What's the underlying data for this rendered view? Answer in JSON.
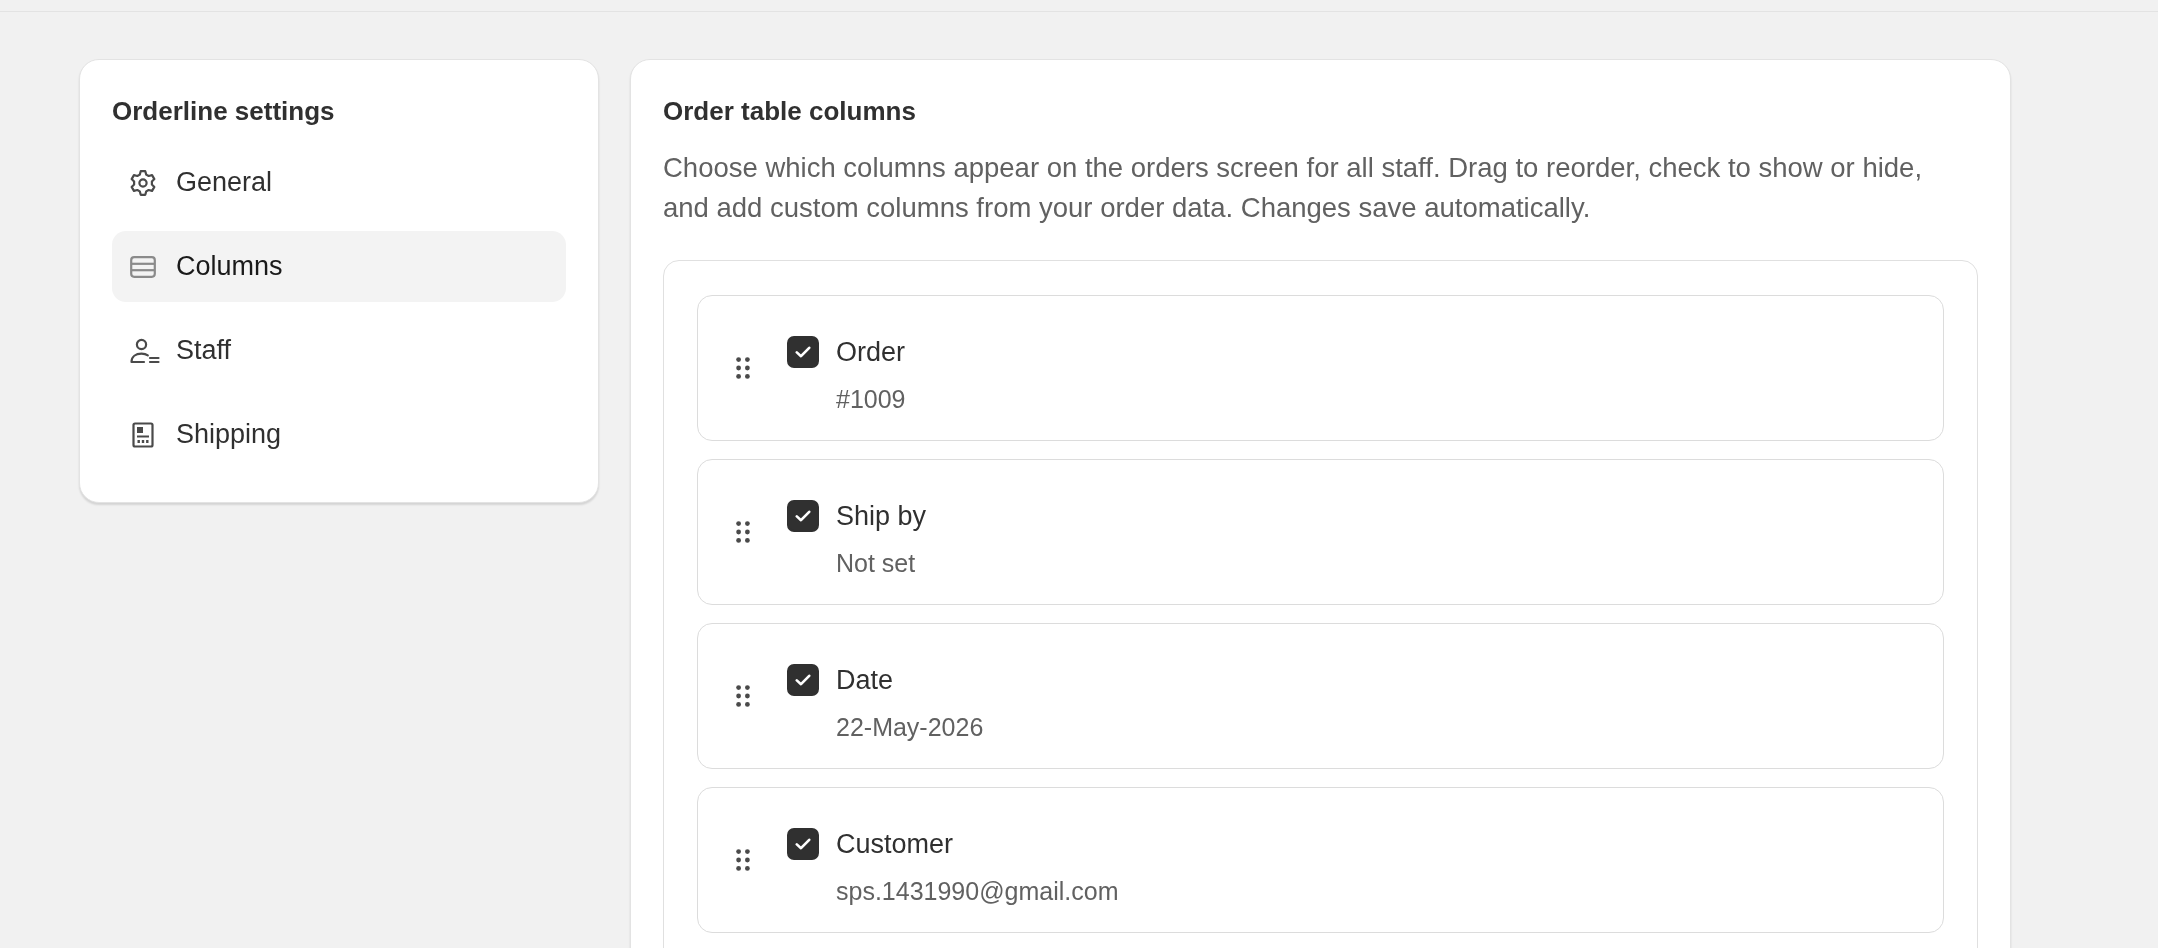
{
  "sidebar": {
    "title": "Orderline settings",
    "items": [
      {
        "label": "General",
        "selected": false
      },
      {
        "label": "Columns",
        "selected": true
      },
      {
        "label": "Staff",
        "selected": false
      },
      {
        "label": "Shipping",
        "selected": false
      }
    ]
  },
  "panel": {
    "title": "Order table columns",
    "description": "Choose which columns appear on the orders screen for all staff. Drag to reorder, check to show or hide, and add custom columns from your order data. Changes save automatically.",
    "columns": [
      {
        "label": "Order",
        "value": "#1009",
        "checked": true
      },
      {
        "label": "Ship by",
        "value": "Not set",
        "checked": true
      },
      {
        "label": "Date",
        "value": "22-May-2026",
        "checked": true
      },
      {
        "label": "Customer",
        "value": "sps.1431990@gmail.com",
        "checked": true
      }
    ]
  }
}
